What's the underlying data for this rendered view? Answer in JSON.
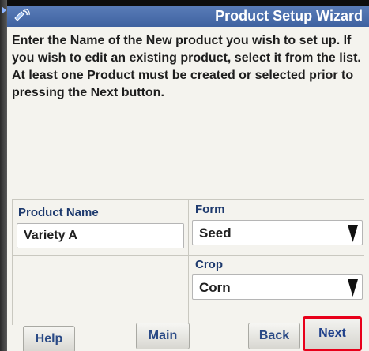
{
  "window": {
    "title": "Product Setup Wizard"
  },
  "instructions": "Enter the Name of the New product you wish to set up. If you wish to edit an existing product, select it from the list. At least one Product must be created or selected prior to pressing the Next button.",
  "form": {
    "product_name_label": "Product Name",
    "product_name_value": "Variety A",
    "form_label": "Form",
    "form_value": "Seed",
    "crop_label": "Crop",
    "crop_value": "Corn"
  },
  "buttons": {
    "help": "Help",
    "main": "Main",
    "back": "Back",
    "next": "Next"
  },
  "icons": {
    "title_icon": "satellite-icon",
    "dropdown_icon": "dropdown-arrow-icon"
  },
  "colors": {
    "title_bar": "#4a6cab",
    "label_text": "#1e3a6e",
    "highlight": "#e8001a"
  }
}
